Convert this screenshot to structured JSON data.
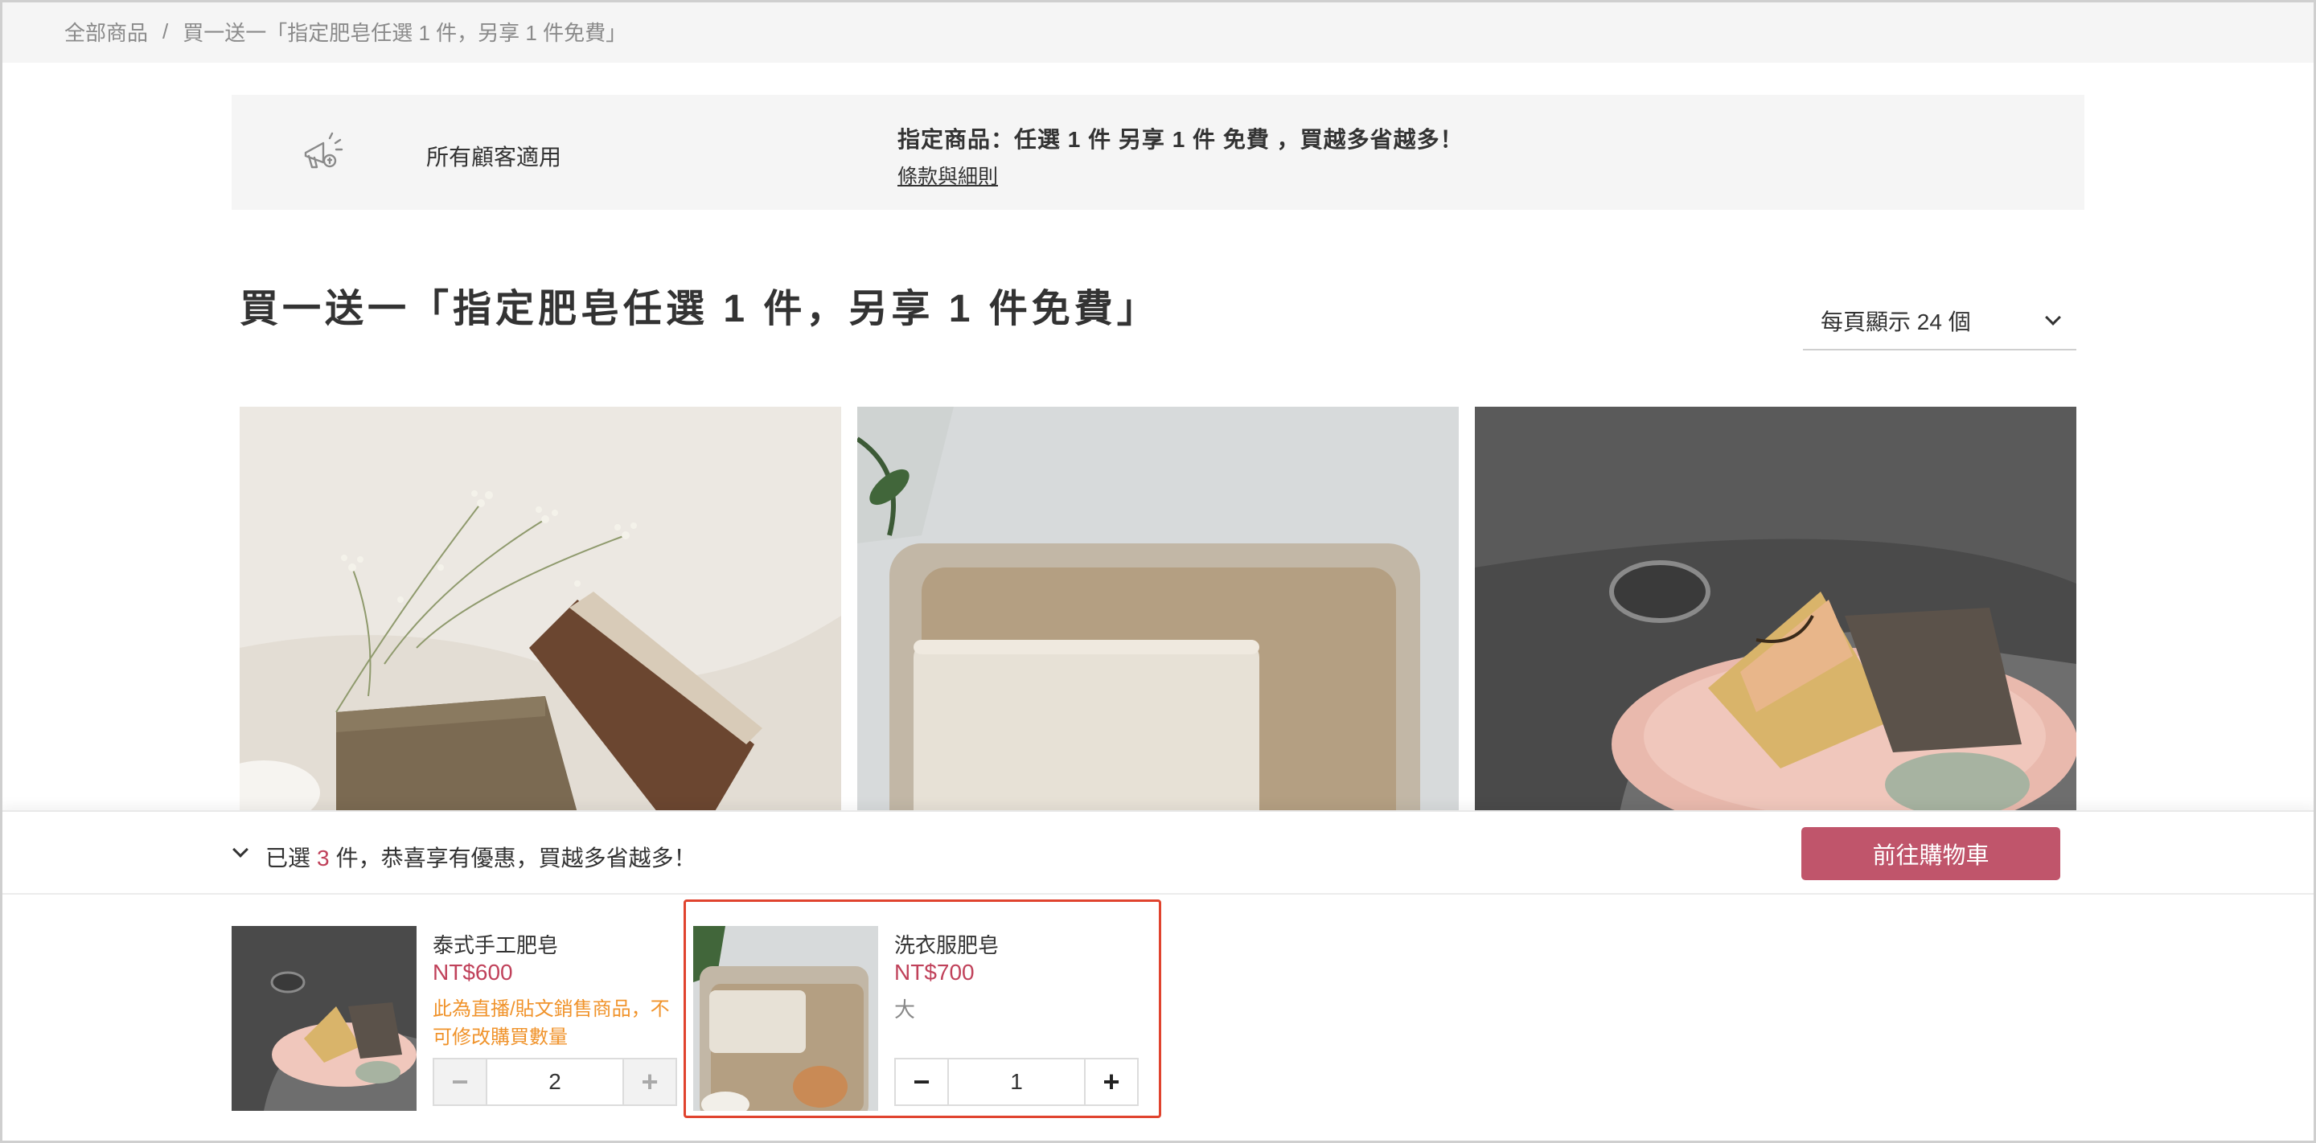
{
  "breadcrumb": {
    "home": "全部商品",
    "separator": "/",
    "current": "買一送一「指定肥皂任選 1 件，另享 1 件免費」"
  },
  "promo": {
    "icon": "megaphone-icon",
    "audience": "所有顧客適用",
    "title": "指定商品：任選 1 件 另享 1 件 免費 ，買越多省越多！",
    "terms_link": "條款與細則"
  },
  "page_title": "買一送一「指定肥皂任選 1 件，另享 1 件免費」",
  "per_page": {
    "label": "每頁顯示 24 個"
  },
  "products": [
    {
      "image": "soap-with-flowers-photo"
    },
    {
      "image": "white-soap-on-towel-photo"
    },
    {
      "image": "soaps-on-pink-dish-photo"
    }
  ],
  "drawer": {
    "summary_prefix": "已選",
    "count": "3",
    "summary_suffix": "件，恭喜享有優惠，買越多省越多！",
    "checkout_label": "前往購物車",
    "items": [
      {
        "name": "泰式手工肥皂",
        "price": "NT$600",
        "note": "此為直播/貼文銷售商品，不可修改購買數量",
        "quantity": "2",
        "minus": "−",
        "plus": "+"
      },
      {
        "name": "洗衣服肥皂",
        "price": "NT$700",
        "variant": "大",
        "quantity": "1",
        "minus": "−",
        "plus": "+"
      }
    ]
  },
  "colors": {
    "accent": "#c0556b",
    "price": "#c0415a",
    "note": "#f0932b",
    "highlight": "#e0432e"
  }
}
